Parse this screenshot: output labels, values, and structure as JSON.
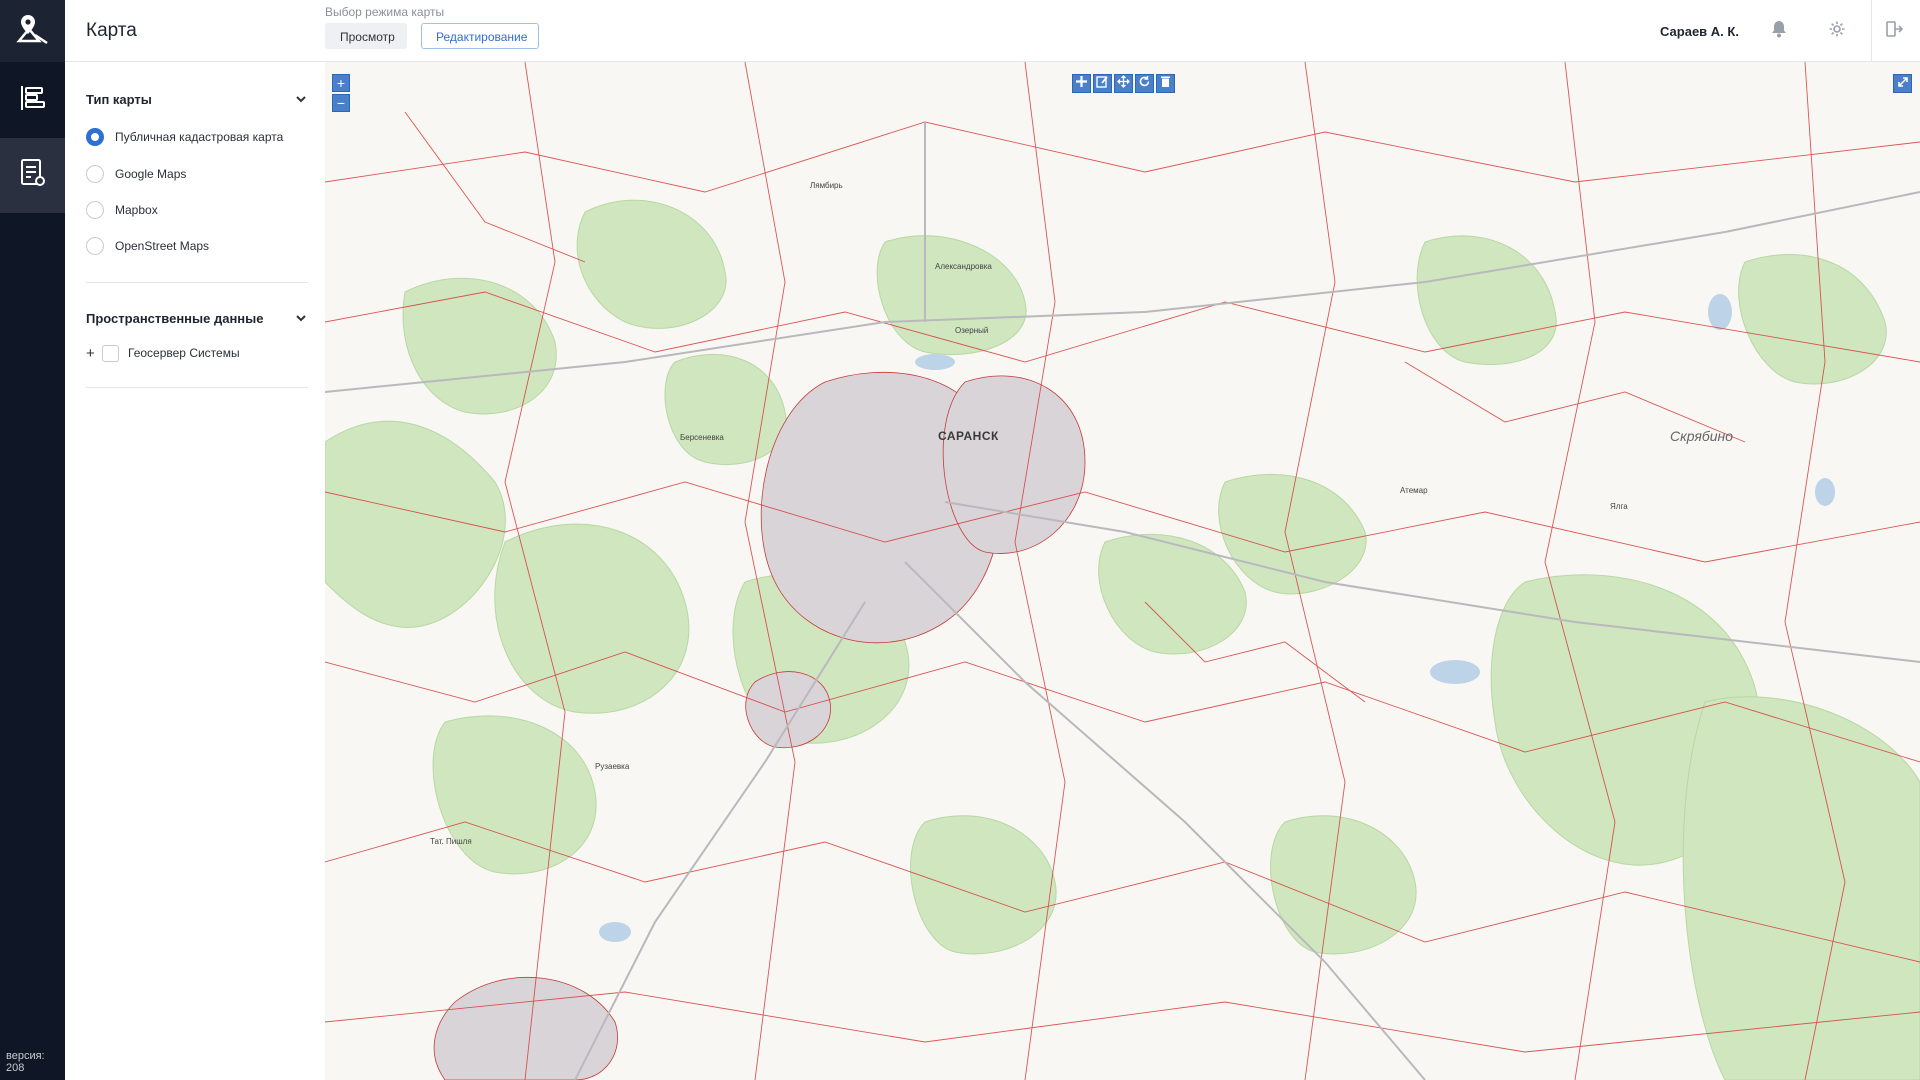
{
  "header": {
    "title": "Карта",
    "mode_label": "Выбор режима карты",
    "mode_view": "Просмотр",
    "mode_edit": "Редактирование",
    "user": "Сараев А. К."
  },
  "sidebar": {
    "version": "версия: 208"
  },
  "panel": {
    "map_type_title": "Тип карты",
    "map_types": [
      {
        "label": "Публичная кадастровая карта",
        "checked": true
      },
      {
        "label": "Google Maps",
        "checked": false
      },
      {
        "label": "Mapbox",
        "checked": false
      },
      {
        "label": "OpenStreet Maps",
        "checked": false
      }
    ],
    "spatial_title": "Пространственные данные",
    "layer_label": "Геосервер Системы"
  },
  "map": {
    "zoom_in": "+",
    "zoom_out": "−",
    "labels": {
      "saransk": "САРАНСК",
      "skryabino": "Скрябино",
      "lyambir": "Лямбирь",
      "ruzaevka": "Рузаевка",
      "tat_pishlya": "Тат. Пишля",
      "atemar": "Атемар",
      "yalga": "Ялга",
      "berseneevka": "Берсеневка",
      "aleksandrovka": "Александровка",
      "ozerny": "Озерный"
    }
  },
  "colors": {
    "rail": "#0f1625",
    "accent": "#2f6fd1",
    "map_bg": "#f7f6f2",
    "forest": "#c9e3b8",
    "cadastre": "#d63b3b"
  }
}
